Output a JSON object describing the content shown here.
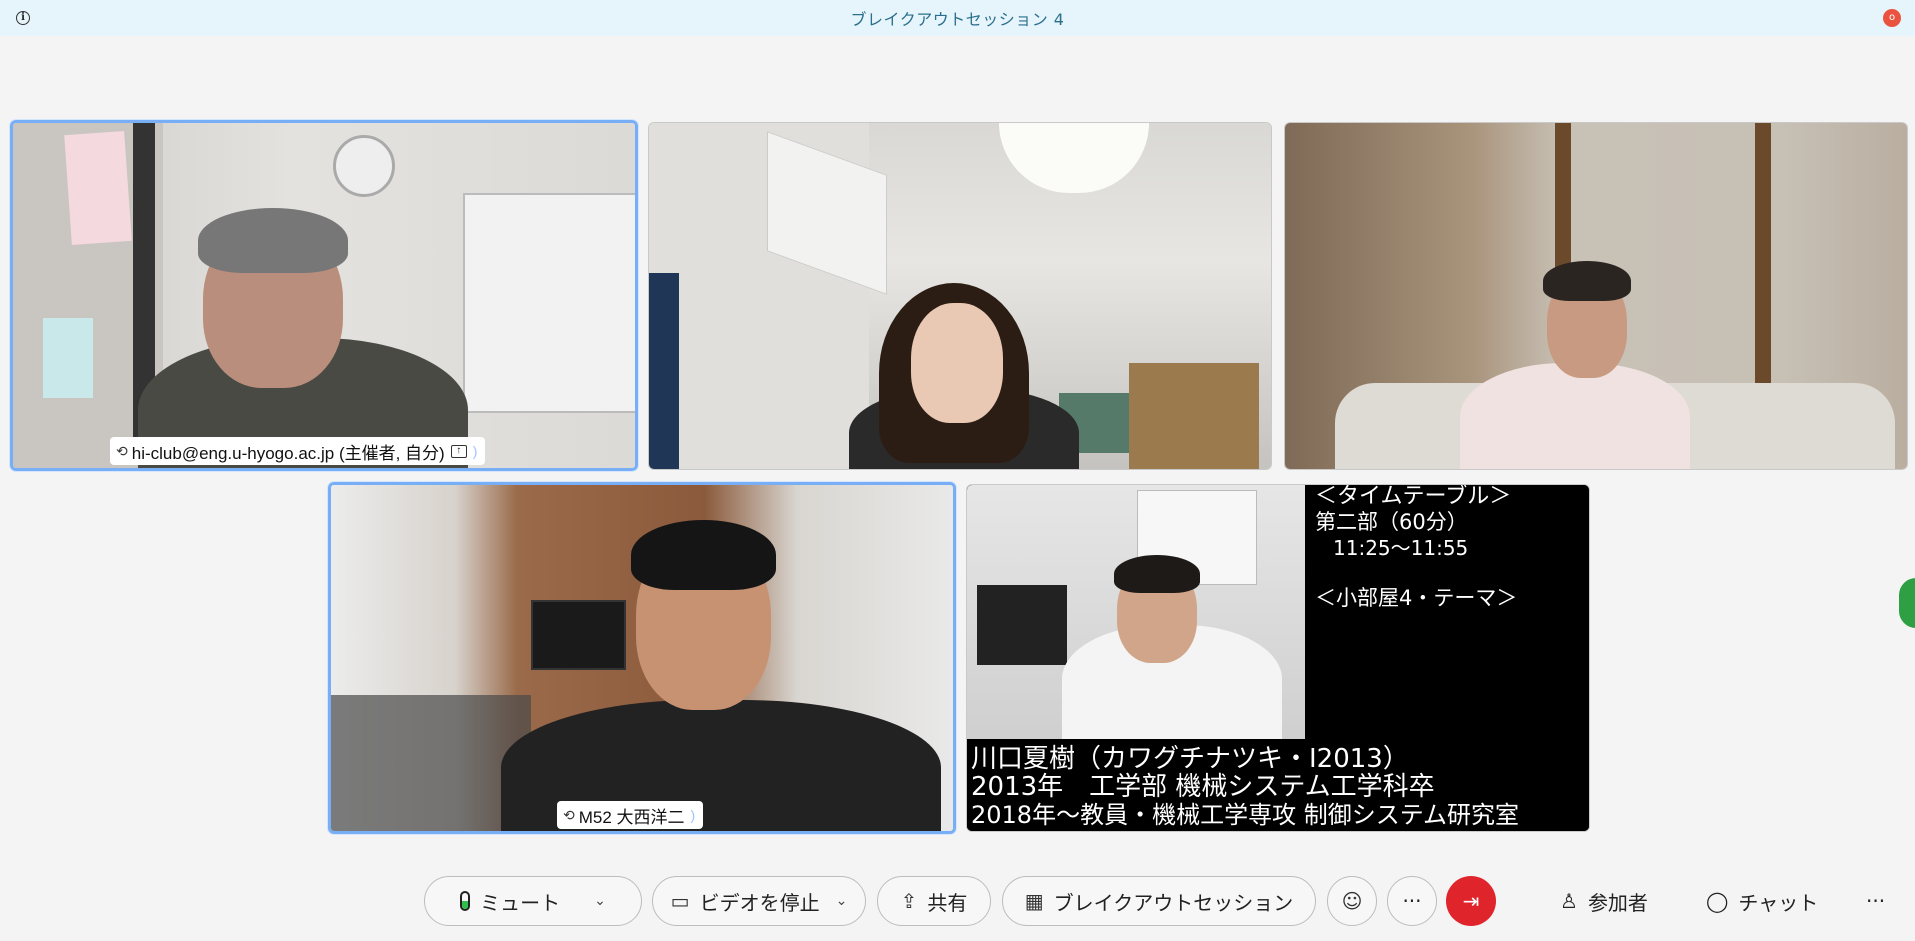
{
  "window": {
    "title": "ブレイクアウトセッション 4",
    "rec_badge": "o"
  },
  "tiles": [
    {
      "name": "hi-club@eng.u-hyogo.ac.jp (主催者, 自分)",
      "active": true
    },
    {
      "name": "",
      "active": false
    },
    {
      "name": "",
      "active": false
    },
    {
      "name": "M52 大西洋二",
      "active": true
    },
    {
      "name": "",
      "active": false
    }
  ],
  "slide": {
    "heading": "＜タイムテーブル＞",
    "part": "第二部（60分）",
    "time": "11:25〜11:55",
    "room_theme": "＜小部屋4・テーマ＞",
    "line1": "川口夏樹（カワグチナツキ・I2013）",
    "line2": "2013年　工学部 機械システム工学科卒",
    "line3": "2018年〜教員・機械工学専攻 制御システム研究室"
  },
  "toolbar": {
    "mute_label": "ミュート",
    "video_label": "ビデオを停止",
    "share_label": "共有",
    "breakout_label": "ブレイクアウトセッション",
    "more_label": "···",
    "participants_label": "参加者",
    "chat_label": "チャット",
    "overflow_label": "···"
  },
  "colors": {
    "accent_border": "#78aef5",
    "leave_red": "#e0242b",
    "titlebar_bg": "#e6f5fb"
  }
}
